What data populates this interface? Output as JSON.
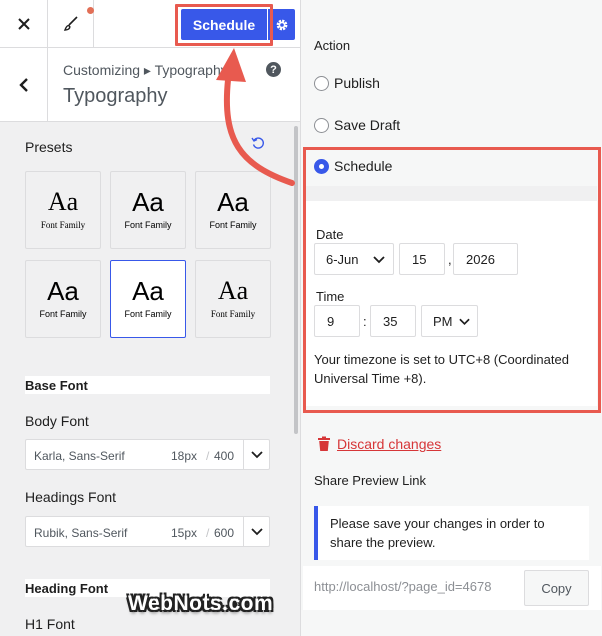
{
  "toolbar": {
    "close_icon": "close-icon",
    "brush_icon": "brush-icon",
    "schedule_label": "Schedule",
    "gear_icon": "gear-icon",
    "accent_color": "#3858e9",
    "notification_color": "#e26f56"
  },
  "header": {
    "breadcrumb": "Customizing ▸ Typography",
    "title": "Typography",
    "help": "?"
  },
  "presets": {
    "label": "Presets",
    "items": [
      {
        "sample": "Aa",
        "caption": "Font Family",
        "style": "serif",
        "selected": false
      },
      {
        "sample": "Aa",
        "caption": "Font Family",
        "style": "sans",
        "selected": false
      },
      {
        "sample": "Aa",
        "caption": "Font Family",
        "style": "sans",
        "selected": false
      },
      {
        "sample": "Aa",
        "caption": "Font Family",
        "style": "sans",
        "selected": false
      },
      {
        "sample": "Aa",
        "caption": "Font Family",
        "style": "sans",
        "selected": true
      },
      {
        "sample": "Aa",
        "caption": "Font Family",
        "style": "serif",
        "selected": false
      }
    ]
  },
  "base_font": {
    "label": "Base Font",
    "body": {
      "label": "Body Font",
      "family": "Karla, Sans-Serif",
      "size": "18px",
      "sep": "/",
      "weight": "400"
    },
    "headings": {
      "label": "Headings Font",
      "family": "Rubik, Sans-Serif",
      "size": "15px",
      "sep": "/",
      "weight": "600"
    }
  },
  "heading_font": {
    "label": "Heading Font",
    "h1_label": "H1 Font"
  },
  "publish": {
    "action_label": "Action",
    "options": [
      {
        "label": "Publish",
        "checked": false
      },
      {
        "label": "Save Draft",
        "checked": false
      },
      {
        "label": "Schedule",
        "checked": true
      }
    ],
    "date_label": "Date",
    "date_month": "6-Jun",
    "date_day": "15",
    "date_sep": ",",
    "date_year": "2026",
    "time_label": "Time",
    "time_hour": "9",
    "time_sep": ":",
    "time_minute": "35",
    "time_ampm": "PM",
    "timezone_text": "Your timezone is set to UTC+8 (Coordinated Universal Time +8).",
    "discard_label": "Discard changes",
    "share_label": "Share Preview Link",
    "share_notice": "Please save your changes in order to share the preview.",
    "share_url": "http://localhost/?page_id=4678",
    "copy_label": "Copy",
    "danger_color": "#d63638",
    "highlight_color": "#e85a4f"
  },
  "watermark": "WebNots.com"
}
